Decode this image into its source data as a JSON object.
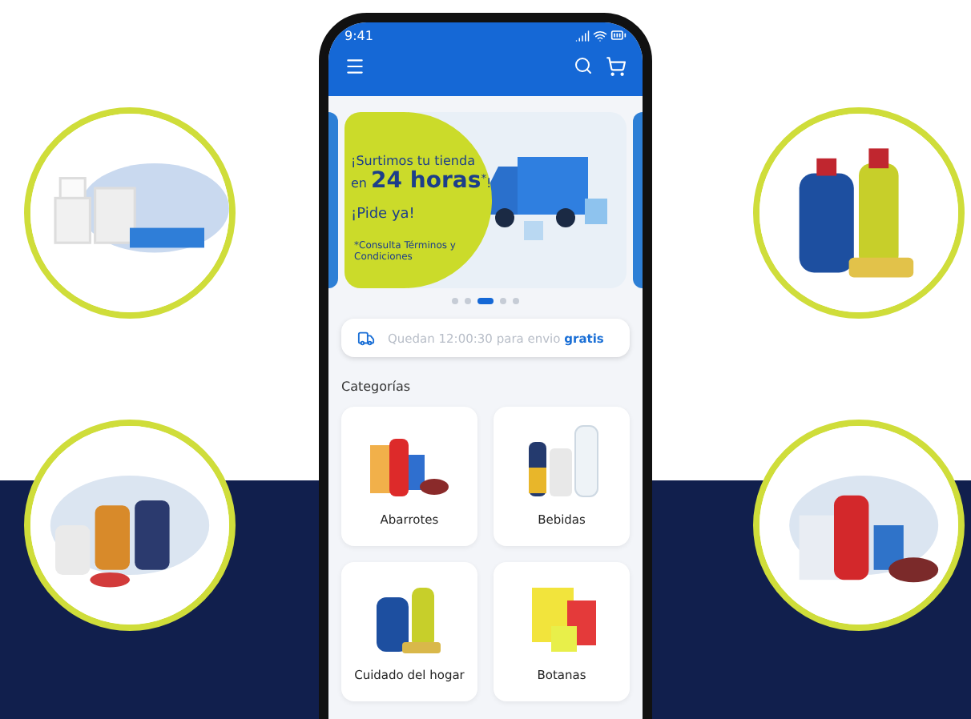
{
  "status_bar": {
    "time": "9:41"
  },
  "banner": {
    "line1": "¡Surtimos tu tienda",
    "line2": "en **24 horas**$^{*}$!",
    "cta": "¡Pide ya!",
    "note": "*Consulta Términos y Condiciones"
  },
  "carousel": {
    "dots": [
      {
        "selected": false
      },
      {
        "selected": false
      },
      {
        "selected": true
      },
      {
        "selected": false
      },
      {
        "selected": false
      }
    ]
  },
  "shipping": {
    "text": "Quedan 12:00:30 para envio **gratis**"
  },
  "categories": {
    "title": "Categorías",
    "items": [
      {
        "label": "Abarrotes",
        "kind": "picture"
      },
      {
        "label": "Bebidas",
        "kind": "picture"
      },
      {
        "label": "Cuidado del hogar",
        "kind": "picture"
      },
      {
        "label": "Botanas",
        "kind": "picture"
      }
    ]
  }
}
